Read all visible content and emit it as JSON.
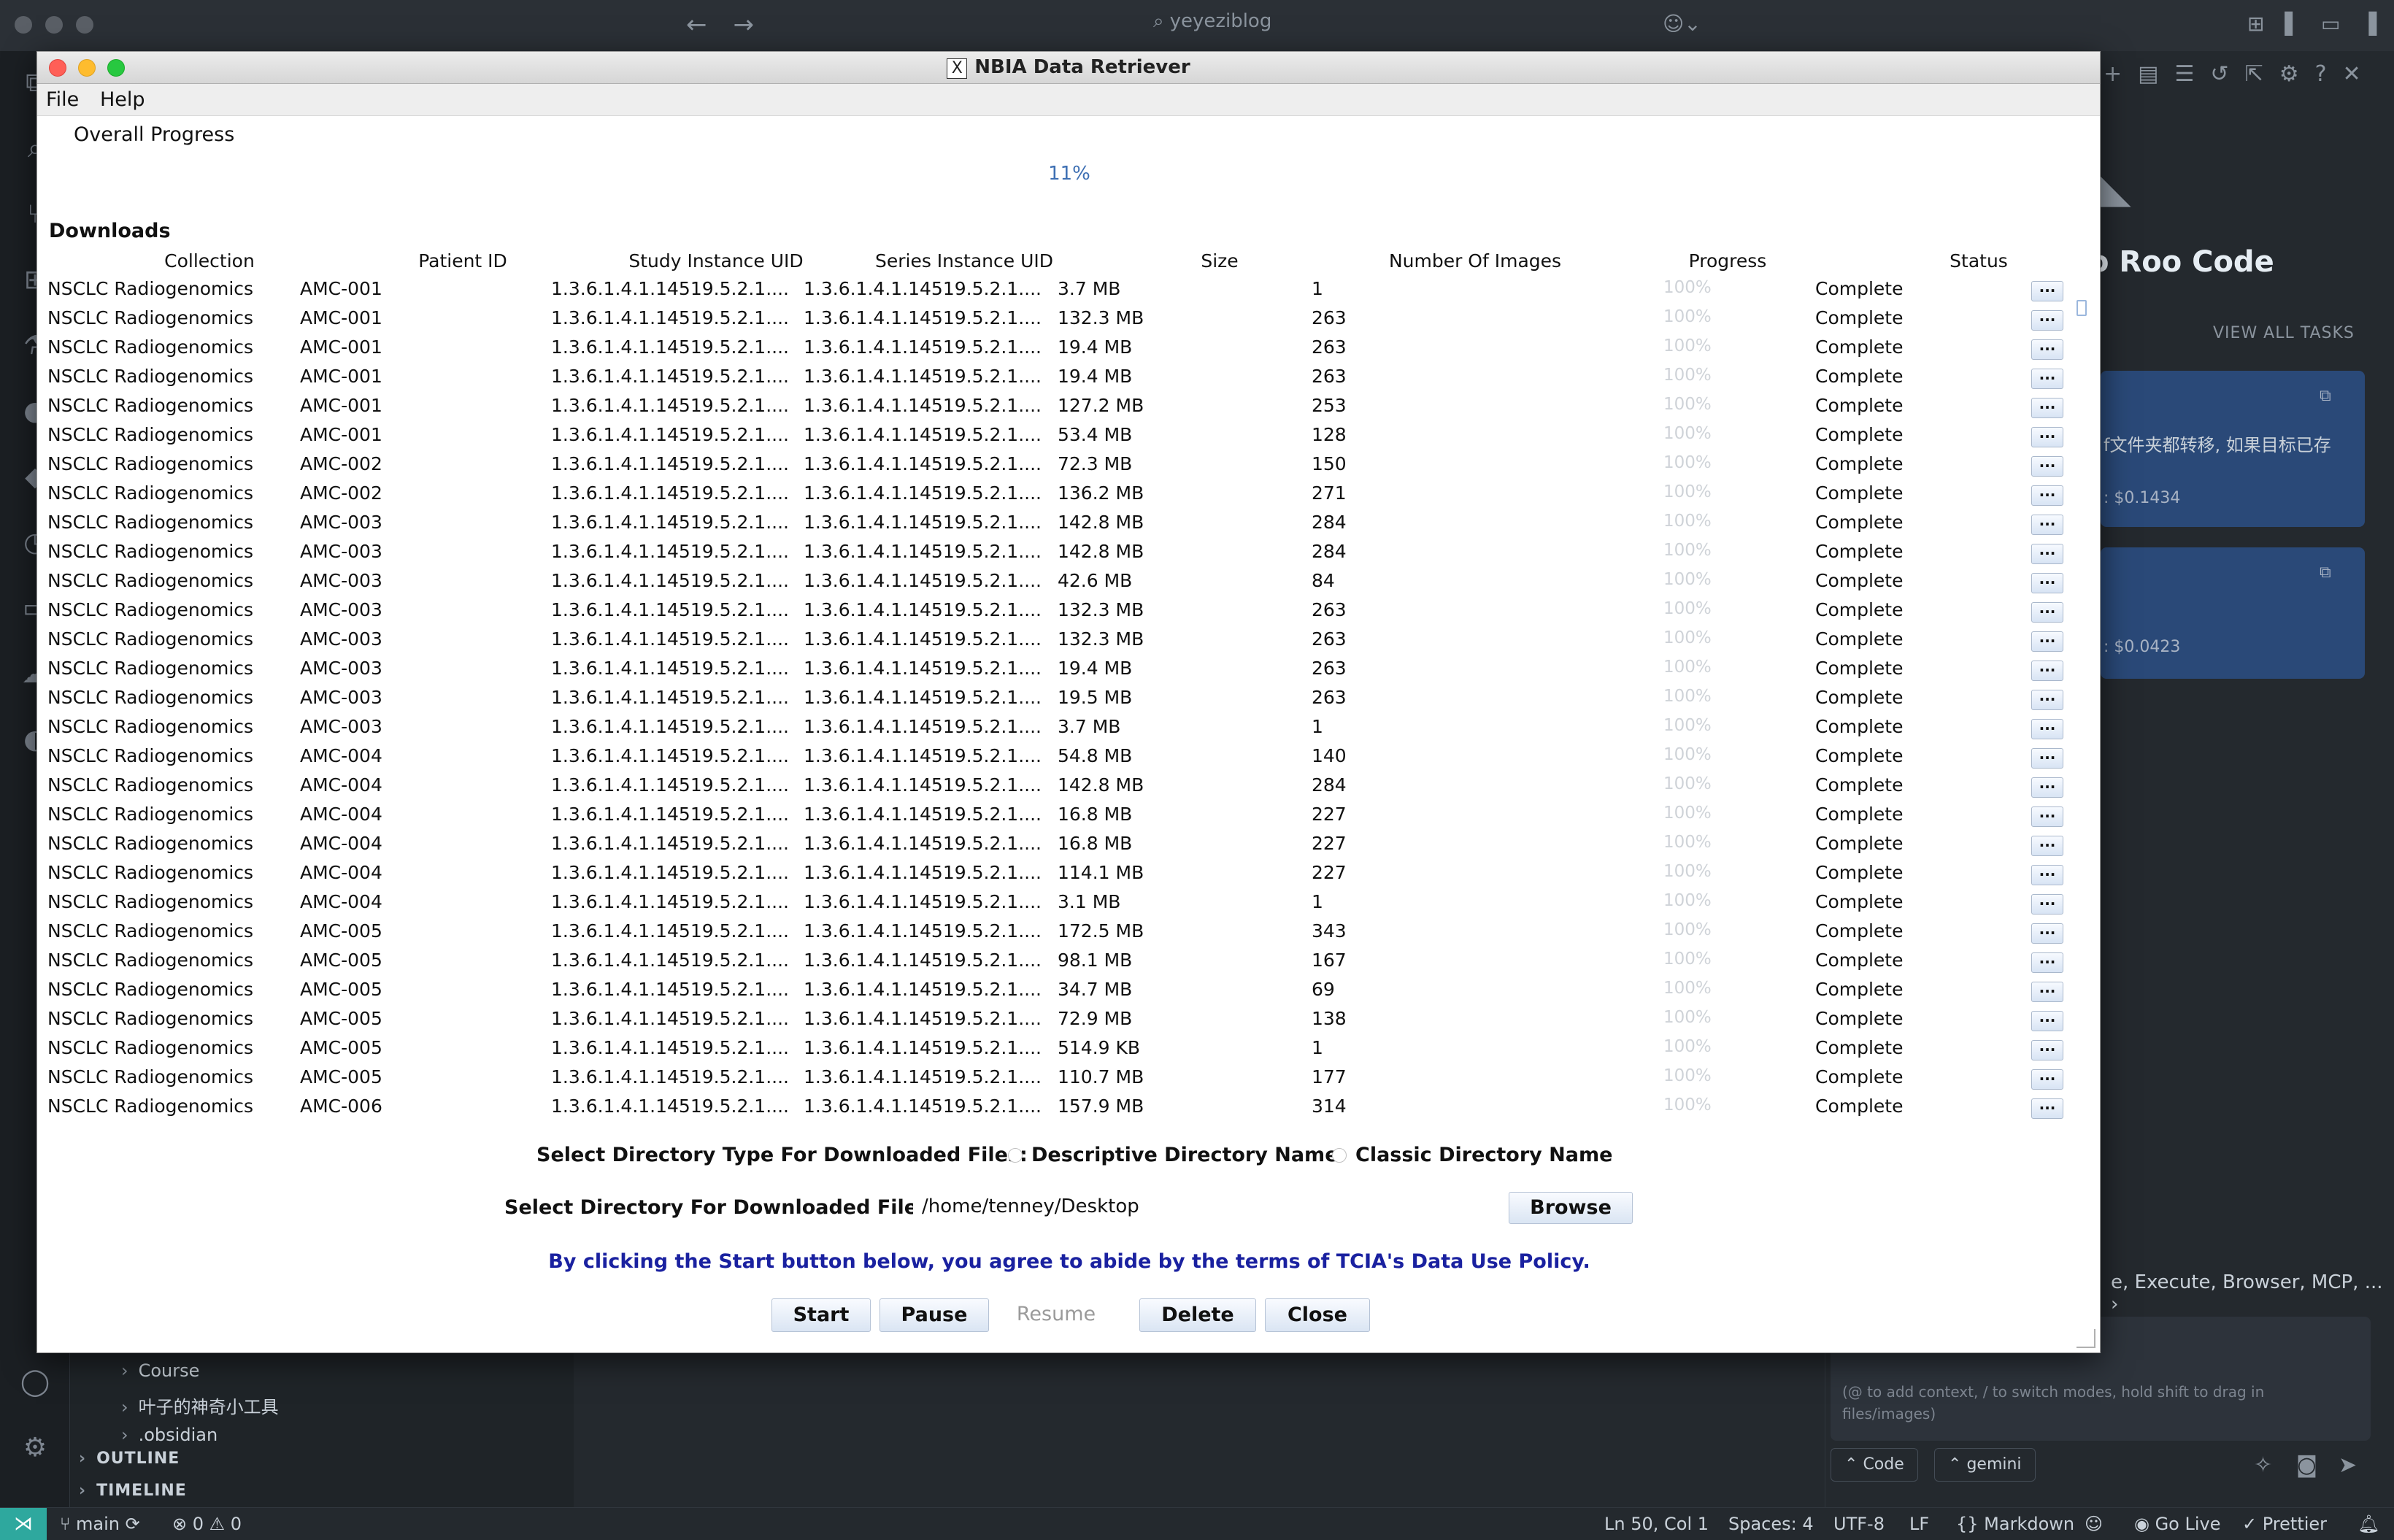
{
  "editor": {
    "search_text": "yeyeziblog",
    "tree_items": [
      "Course",
      "叶子的神奇小工具",
      ".obsidian"
    ],
    "sections": [
      "OUTLINE",
      "TIMELINE"
    ]
  },
  "roo": {
    "title": "o Roo Code",
    "view_all": "VIEW ALL TASKS",
    "tasks": [
      {
        "text": "f文件夹都转移, 如果目标已存",
        "cost": ": $0.1434"
      },
      {
        "text": "",
        "cost": ": $0.0423"
      }
    ],
    "tools_text": "e, Execute, Browser, MCP, ...",
    "input_placeholder": "(@ to add context, / to switch modes, hold shift to drag in files/images)",
    "mode_chip": "Code",
    "model_chip": "gemini"
  },
  "statusbar": {
    "branch": "main",
    "problems": "⊗ 0 ⚠ 0",
    "position": "Ln 50, Col 1",
    "spaces": "Spaces: 4",
    "encoding": "UTF-8",
    "eol": "LF",
    "language": "Markdown",
    "golive": "Go Live",
    "prettier": "Prettier"
  },
  "dialog": {
    "title": "NBIA Data Retriever",
    "x_glyph": "X",
    "menu": [
      "File",
      "Help"
    ],
    "overall_label": "Overall Progress",
    "overall_percent": "11%",
    "downloads_label": "Downloads",
    "columns": [
      "Collection",
      "Patient ID",
      "Study Instance UID",
      "Series Instance UID",
      "Size",
      "Number Of Images",
      "Progress",
      "Status"
    ],
    "rows": [
      [
        "NSCLC Radiogenomics",
        "AMC-001",
        "1.3.6.1.4.1.14519.5.2.1....",
        "1.3.6.1.4.1.14519.5.2.1....",
        "3.7 MB",
        "1",
        "100%",
        "Complete"
      ],
      [
        "NSCLC Radiogenomics",
        "AMC-001",
        "1.3.6.1.4.1.14519.5.2.1....",
        "1.3.6.1.4.1.14519.5.2.1....",
        "132.3 MB",
        "263",
        "100%",
        "Complete"
      ],
      [
        "NSCLC Radiogenomics",
        "AMC-001",
        "1.3.6.1.4.1.14519.5.2.1....",
        "1.3.6.1.4.1.14519.5.2.1....",
        "19.4 MB",
        "263",
        "100%",
        "Complete"
      ],
      [
        "NSCLC Radiogenomics",
        "AMC-001",
        "1.3.6.1.4.1.14519.5.2.1....",
        "1.3.6.1.4.1.14519.5.2.1....",
        "19.4 MB",
        "263",
        "100%",
        "Complete"
      ],
      [
        "NSCLC Radiogenomics",
        "AMC-001",
        "1.3.6.1.4.1.14519.5.2.1....",
        "1.3.6.1.4.1.14519.5.2.1....",
        "127.2 MB",
        "253",
        "100%",
        "Complete"
      ],
      [
        "NSCLC Radiogenomics",
        "AMC-001",
        "1.3.6.1.4.1.14519.5.2.1....",
        "1.3.6.1.4.1.14519.5.2.1....",
        "53.4 MB",
        "128",
        "100%",
        "Complete"
      ],
      [
        "NSCLC Radiogenomics",
        "AMC-002",
        "1.3.6.1.4.1.14519.5.2.1....",
        "1.3.6.1.4.1.14519.5.2.1....",
        "72.3 MB",
        "150",
        "100%",
        "Complete"
      ],
      [
        "NSCLC Radiogenomics",
        "AMC-002",
        "1.3.6.1.4.1.14519.5.2.1....",
        "1.3.6.1.4.1.14519.5.2.1....",
        "136.2 MB",
        "271",
        "100%",
        "Complete"
      ],
      [
        "NSCLC Radiogenomics",
        "AMC-003",
        "1.3.6.1.4.1.14519.5.2.1....",
        "1.3.6.1.4.1.14519.5.2.1....",
        "142.8 MB",
        "284",
        "100%",
        "Complete"
      ],
      [
        "NSCLC Radiogenomics",
        "AMC-003",
        "1.3.6.1.4.1.14519.5.2.1....",
        "1.3.6.1.4.1.14519.5.2.1....",
        "142.8 MB",
        "284",
        "100%",
        "Complete"
      ],
      [
        "NSCLC Radiogenomics",
        "AMC-003",
        "1.3.6.1.4.1.14519.5.2.1....",
        "1.3.6.1.4.1.14519.5.2.1....",
        "42.6 MB",
        "84",
        "100%",
        "Complete"
      ],
      [
        "NSCLC Radiogenomics",
        "AMC-003",
        "1.3.6.1.4.1.14519.5.2.1....",
        "1.3.6.1.4.1.14519.5.2.1....",
        "132.3 MB",
        "263",
        "100%",
        "Complete"
      ],
      [
        "NSCLC Radiogenomics",
        "AMC-003",
        "1.3.6.1.4.1.14519.5.2.1....",
        "1.3.6.1.4.1.14519.5.2.1....",
        "132.3 MB",
        "263",
        "100%",
        "Complete"
      ],
      [
        "NSCLC Radiogenomics",
        "AMC-003",
        "1.3.6.1.4.1.14519.5.2.1....",
        "1.3.6.1.4.1.14519.5.2.1....",
        "19.4 MB",
        "263",
        "100%",
        "Complete"
      ],
      [
        "NSCLC Radiogenomics",
        "AMC-003",
        "1.3.6.1.4.1.14519.5.2.1....",
        "1.3.6.1.4.1.14519.5.2.1....",
        "19.5 MB",
        "263",
        "100%",
        "Complete"
      ],
      [
        "NSCLC Radiogenomics",
        "AMC-003",
        "1.3.6.1.4.1.14519.5.2.1....",
        "1.3.6.1.4.1.14519.5.2.1....",
        "3.7 MB",
        "1",
        "100%",
        "Complete"
      ],
      [
        "NSCLC Radiogenomics",
        "AMC-004",
        "1.3.6.1.4.1.14519.5.2.1....",
        "1.3.6.1.4.1.14519.5.2.1....",
        "54.8 MB",
        "140",
        "100%",
        "Complete"
      ],
      [
        "NSCLC Radiogenomics",
        "AMC-004",
        "1.3.6.1.4.1.14519.5.2.1....",
        "1.3.6.1.4.1.14519.5.2.1....",
        "142.8 MB",
        "284",
        "100%",
        "Complete"
      ],
      [
        "NSCLC Radiogenomics",
        "AMC-004",
        "1.3.6.1.4.1.14519.5.2.1....",
        "1.3.6.1.4.1.14519.5.2.1....",
        "16.8 MB",
        "227",
        "100%",
        "Complete"
      ],
      [
        "NSCLC Radiogenomics",
        "AMC-004",
        "1.3.6.1.4.1.14519.5.2.1....",
        "1.3.6.1.4.1.14519.5.2.1....",
        "16.8 MB",
        "227",
        "100%",
        "Complete"
      ],
      [
        "NSCLC Radiogenomics",
        "AMC-004",
        "1.3.6.1.4.1.14519.5.2.1....",
        "1.3.6.1.4.1.14519.5.2.1....",
        "114.1 MB",
        "227",
        "100%",
        "Complete"
      ],
      [
        "NSCLC Radiogenomics",
        "AMC-004",
        "1.3.6.1.4.1.14519.5.2.1....",
        "1.3.6.1.4.1.14519.5.2.1....",
        "3.1 MB",
        "1",
        "100%",
        "Complete"
      ],
      [
        "NSCLC Radiogenomics",
        "AMC-005",
        "1.3.6.1.4.1.14519.5.2.1....",
        "1.3.6.1.4.1.14519.5.2.1....",
        "172.5 MB",
        "343",
        "100%",
        "Complete"
      ],
      [
        "NSCLC Radiogenomics",
        "AMC-005",
        "1.3.6.1.4.1.14519.5.2.1....",
        "1.3.6.1.4.1.14519.5.2.1....",
        "98.1 MB",
        "167",
        "100%",
        "Complete"
      ],
      [
        "NSCLC Radiogenomics",
        "AMC-005",
        "1.3.6.1.4.1.14519.5.2.1....",
        "1.3.6.1.4.1.14519.5.2.1....",
        "34.7 MB",
        "69",
        "100%",
        "Complete"
      ],
      [
        "NSCLC Radiogenomics",
        "AMC-005",
        "1.3.6.1.4.1.14519.5.2.1....",
        "1.3.6.1.4.1.14519.5.2.1....",
        "72.9 MB",
        "138",
        "100%",
        "Complete"
      ],
      [
        "NSCLC Radiogenomics",
        "AMC-005",
        "1.3.6.1.4.1.14519.5.2.1....",
        "1.3.6.1.4.1.14519.5.2.1....",
        "514.9 KB",
        "1",
        "100%",
        "Complete"
      ],
      [
        "NSCLC Radiogenomics",
        "AMC-005",
        "1.3.6.1.4.1.14519.5.2.1....",
        "1.3.6.1.4.1.14519.5.2.1....",
        "110.7 MB",
        "177",
        "100%",
        "Complete"
      ],
      [
        "NSCLC Radiogenomics",
        "AMC-006",
        "1.3.6.1.4.1.14519.5.2.1....",
        "1.3.6.1.4.1.14519.5.2.1....",
        "157.9 MB",
        "314",
        "100%",
        "Complete"
      ]
    ],
    "more_label": "...",
    "dir_type_label": "Select Directory Type For Downloaded Files:",
    "dir_type_options": [
      "Descriptive Directory Name",
      "Classic Directory Name"
    ],
    "dir_label": "Select Directory For Downloaded Files:",
    "dir_value": "/home/tenney/Desktop",
    "browse_label": "Browse",
    "policy_text": "By clicking the Start button below, you agree to abide by the terms of TCIA's Data Use Policy.",
    "buttons": {
      "start": "Start",
      "pause": "Pause",
      "resume": "Resume",
      "delete": "Delete",
      "close": "Close"
    }
  }
}
